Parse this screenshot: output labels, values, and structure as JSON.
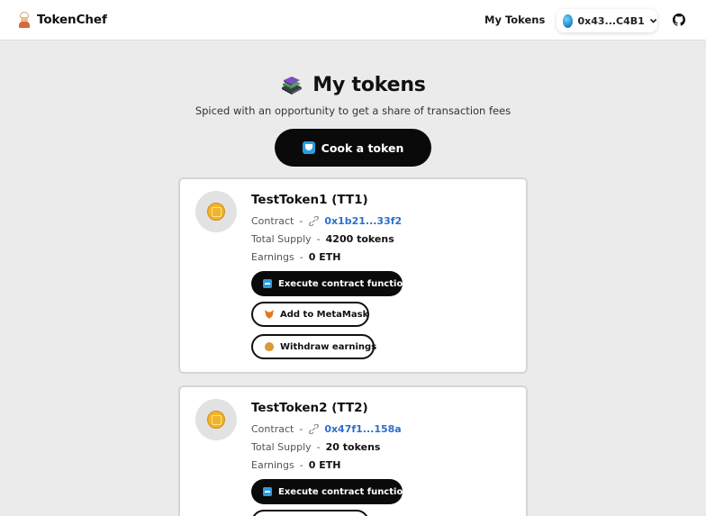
{
  "header": {
    "brand": "TokenChef",
    "nav_my_tokens": "My Tokens",
    "wallet_address": "0x43...C4B1"
  },
  "hero": {
    "title": "My tokens",
    "subtitle": "Spiced with an opportunity to get a share of transaction fees",
    "cook_button": "Cook a token"
  },
  "labels": {
    "contract": "Contract",
    "total_supply": "Total Supply",
    "earnings": "Earnings",
    "dash": "-",
    "execute": "Execute contract function",
    "add_metamask": "Add to MetaMask",
    "withdraw": "Withdraw earnings"
  },
  "tokens": [
    {
      "name": "TestToken1 (TT1)",
      "contract": "0x1b21...33f2",
      "supply": "4200 tokens",
      "earnings": "0 ETH"
    },
    {
      "name": "TestToken2 (TT2)",
      "contract": "0x47f1...158a",
      "supply": "20 tokens",
      "earnings": "0 ETH"
    }
  ],
  "colors": {
    "accent_link": "#2c6fcc",
    "button_dark": "#0a0a0a",
    "page_bg": "#ebebeb"
  },
  "icons": {
    "brand": "chef-icon",
    "title": "books-icon",
    "wallet": "wallet-avatar-icon",
    "github": "github-icon",
    "token": "coin-icon"
  }
}
